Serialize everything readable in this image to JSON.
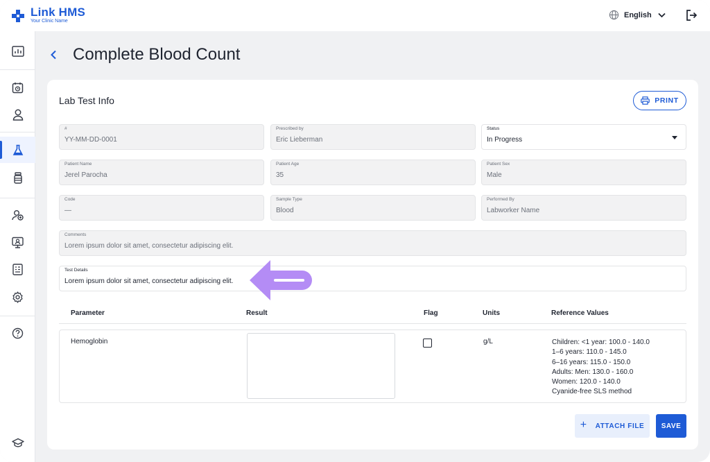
{
  "brand": {
    "name": "Link HMS",
    "tagline": "Your Clinic Name",
    "color": "#1e5bd6"
  },
  "topbar": {
    "language": "English",
    "icons": [
      "globe-icon",
      "chevron-down-icon",
      "logout-icon"
    ]
  },
  "sidebar": {
    "items": [
      {
        "icon": "dashboard-icon"
      },
      {
        "icon": "appointments-icon"
      },
      {
        "icon": "patient-icon"
      },
      {
        "icon": "lab-flask-icon",
        "active": true
      },
      {
        "icon": "pharmacy-bottle-icon"
      },
      {
        "icon": "staff-icon"
      },
      {
        "icon": "monitor-icon"
      },
      {
        "icon": "reports-icon"
      },
      {
        "icon": "settings-icon"
      },
      {
        "icon": "help-icon"
      },
      {
        "icon": "education-cap-icon"
      }
    ]
  },
  "page": {
    "title": "Complete Blood Count"
  },
  "card": {
    "title": "Lab Test Info",
    "print_label": "PRINT"
  },
  "fields": {
    "id": {
      "label": "#",
      "value": "YY-MM-DD-0001"
    },
    "prescribed_by": {
      "label": "Prescribed by",
      "value": "Eric Lieberman"
    },
    "status": {
      "label": "Status",
      "value": "In Progress"
    },
    "patient_name": {
      "label": "Patient Name",
      "value": "Jerel Parocha"
    },
    "patient_age": {
      "label": "Patient Age",
      "value": "35"
    },
    "patient_sex": {
      "label": "Patient Sex",
      "value": "Male"
    },
    "code": {
      "label": "Code",
      "value": "—"
    },
    "sample_type": {
      "label": "Sample Type",
      "value": "Blood"
    },
    "performed_by": {
      "label": "Performed By",
      "value": "Labworker Name"
    },
    "comments": {
      "label": "Comments",
      "value": "Lorem ipsum dolor sit amet, consectetur adipiscing elit."
    },
    "test_details": {
      "label": "Test Details",
      "value": "Lorem ipsum dolor sit amet, consectetur adipiscing elit."
    }
  },
  "table": {
    "headers": {
      "parameter": "Parameter",
      "result": "Result",
      "flag": "Flag",
      "units": "Units",
      "reference": "Reference Values"
    },
    "rows": [
      {
        "parameter": "Hemoglobin",
        "result": "",
        "flag": false,
        "units": "g/L",
        "reference": [
          "Children: <1 year: 100.0 - 140.0",
          "1–6 years: 110.0 - 145.0",
          "6–16 years: 115.0 - 150.0",
          "Adults: Men: 130.0 - 160.0",
          "Women: 120.0 - 140.0",
          "Cyanide-free SLS method"
        ]
      }
    ]
  },
  "actions": {
    "attach_label": "ATTACH FILE",
    "save_label": "SAVE"
  },
  "annotation": {
    "arrow_color": "#b48cf5"
  }
}
